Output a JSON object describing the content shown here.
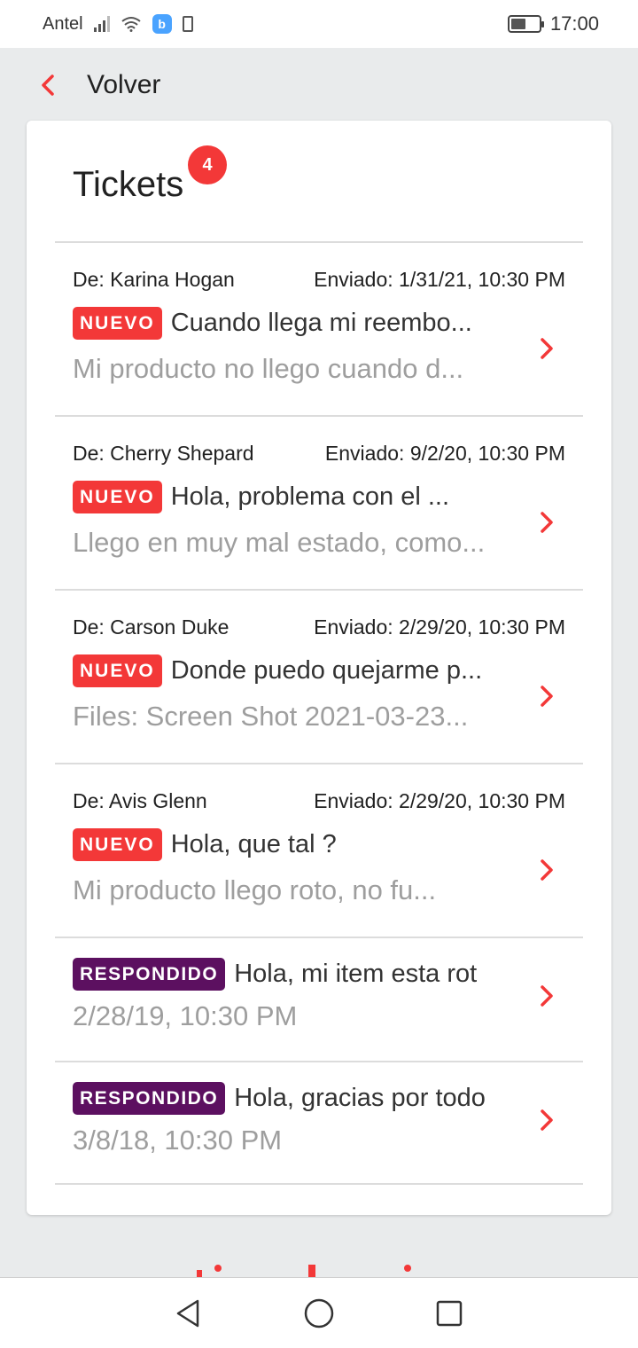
{
  "status_bar": {
    "carrier": "Antel",
    "time": "17:00",
    "battery_level": 0.55
  },
  "header": {
    "back_label": "Volver"
  },
  "card": {
    "title": "Tickets",
    "badge_count": "4"
  },
  "tickets": [
    {
      "from": "De: Karina Hogan",
      "sent": "Enviado: 1/31/21, 10:30 PM",
      "status": "NUEVO",
      "subject": "Cuando llega mi reembo...",
      "preview": "Mi producto no llego cuando d..."
    },
    {
      "from": "De: Cherry Shepard",
      "sent": "Enviado: 9/2/20, 10:30 PM",
      "status": "NUEVO",
      "subject": "Hola, problema con el ...",
      "preview": "Llego en muy mal estado, como..."
    },
    {
      "from": "De: Carson Duke",
      "sent": "Enviado: 2/29/20, 10:30 PM",
      "status": "NUEVO",
      "subject": "Donde puedo quejarme p...",
      "preview": "Files: Screen Shot 2021-03-23..."
    },
    {
      "from": "De: Avis Glenn",
      "sent": "Enviado: 2/29/20, 10:30 PM",
      "status": "NUEVO",
      "subject": "Hola, que tal ?",
      "preview": "Mi producto llego roto, no fu..."
    },
    {
      "status": "RESPONDIDO",
      "subject": "Hola, mi item esta rot",
      "preview": "2/28/19, 10:30 PM"
    },
    {
      "status": "RESPONDIDO",
      "subject": "Hola, gracias por todo",
      "preview": "3/8/18, 10:30 PM"
    }
  ],
  "colors": {
    "accent": "#f33838",
    "responded": "#5c1060",
    "background": "#e9ebec",
    "muted_text": "#9e9e9e"
  },
  "icons": {
    "back": "chevron-left-icon",
    "row": "chevron-right-icon",
    "nav": [
      "back-triangle-icon",
      "home-circle-icon",
      "recents-square-icon"
    ]
  }
}
